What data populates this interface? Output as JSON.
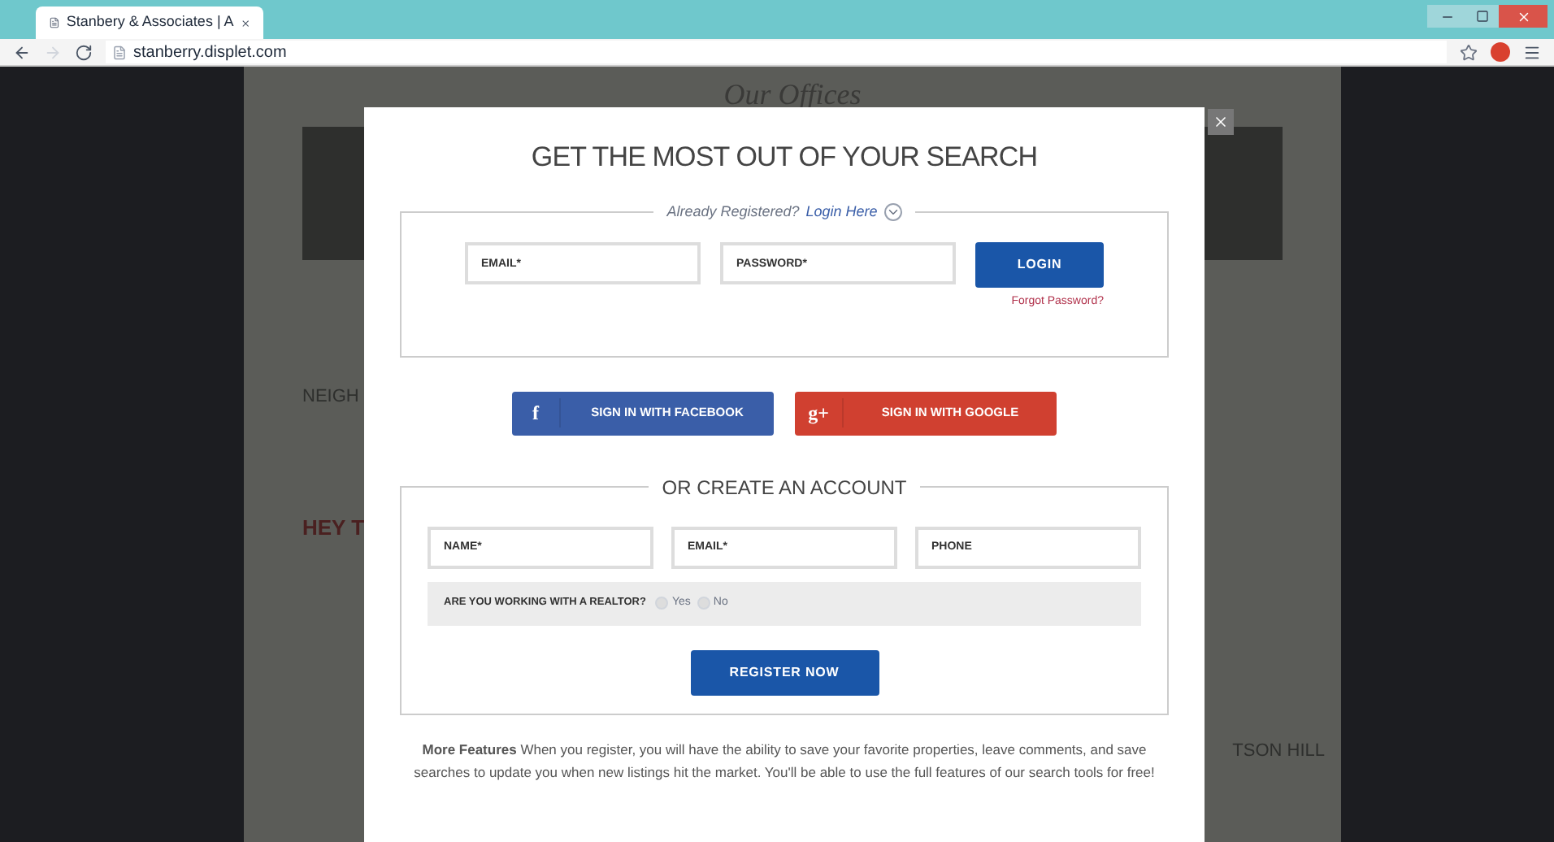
{
  "browser": {
    "tab_title": "Stanbery & Associates | A",
    "url": "stanberry.displet.com"
  },
  "background": {
    "heading": "Our Offices",
    "texts": [
      "NEIGH",
      "HEY T",
      "TSON HILL"
    ]
  },
  "modal": {
    "title": "GET THE MOST OUT OF YOUR SEARCH",
    "login": {
      "legend": "Already Registered?",
      "legend_link": "Login Here",
      "fields": [
        {
          "placeholder": "EMAIL*"
        },
        {
          "placeholder": "PASSWORD*"
        }
      ],
      "button": "LOGIN",
      "forgot": "Forgot Password?"
    },
    "social": [
      {
        "kind": "facebook",
        "glyph": "f",
        "label": "SIGN IN WITH FACEBOOK"
      },
      {
        "kind": "google",
        "glyph": "g+",
        "label": "SIGN IN WITH GOOGLE"
      }
    ],
    "register": {
      "legend": "OR CREATE AN ACCOUNT",
      "fields": [
        {
          "placeholder": "NAME*"
        },
        {
          "placeholder": "EMAIL*"
        },
        {
          "placeholder": "PHONE"
        }
      ],
      "question": "ARE YOU WORKING WITH A REALTOR?",
      "options": [
        {
          "label": "Yes",
          "selected": false
        },
        {
          "label": "No",
          "selected": false
        }
      ],
      "button": "REGISTER NOW"
    },
    "paragraph": "**More Features** When you register, you will have the ability to save your favorite properties, leave comments, and save searches to update you when new listings hit the market. You'll be able to use the full features of our search tools for free!"
  }
}
